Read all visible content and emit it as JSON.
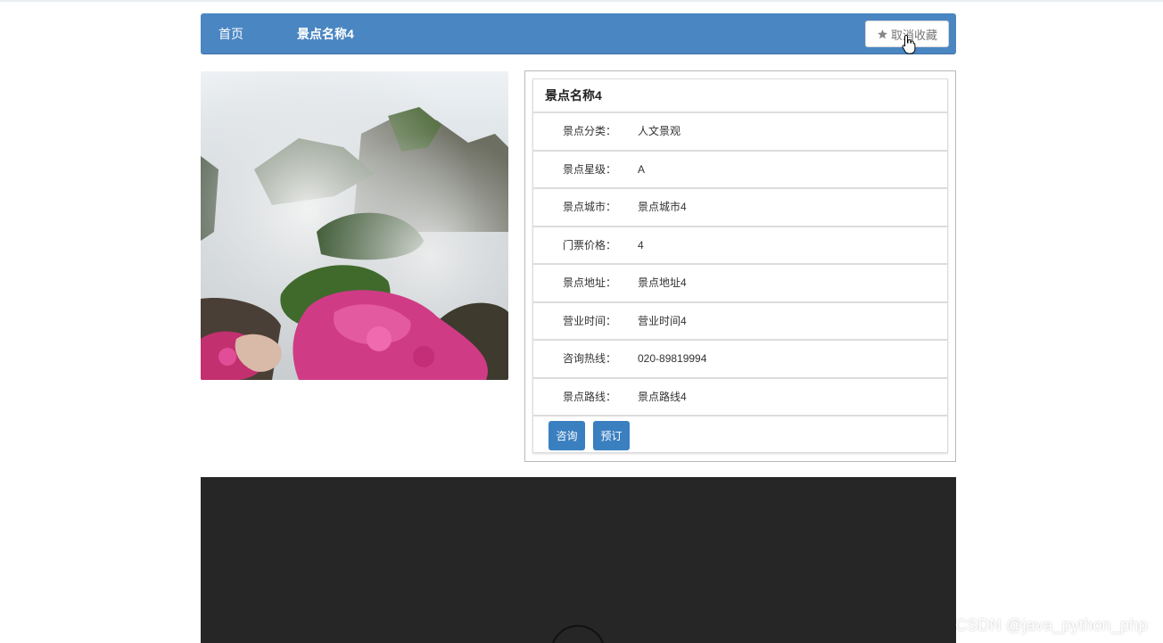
{
  "navbar": {
    "home_label": "首页",
    "current_label": "景点名称4",
    "favorite_button_label": "取消收藏",
    "favorite_icon": "star-icon",
    "bg_color": "#4a86c2"
  },
  "scenic": {
    "title": "景点名称4",
    "fields": [
      {
        "label": "景点分类：",
        "value": "人文景观"
      },
      {
        "label": "景点星级：",
        "value": "A"
      },
      {
        "label": "景点城市：",
        "value": "景点城市4"
      },
      {
        "label": "门票价格：",
        "value": "4"
      },
      {
        "label": "景点地址：",
        "value": "景点地址4"
      },
      {
        "label": "营业时间：",
        "value": "营业时间4"
      },
      {
        "label": "咨询热线：",
        "value": "020-89819994"
      },
      {
        "label": "景点路线：",
        "value": "景点路线4"
      }
    ],
    "consult_label": "咨询",
    "book_label": "预订",
    "button_color": "#3a7fc0"
  },
  "watermark": "CSDN @java_python_php"
}
